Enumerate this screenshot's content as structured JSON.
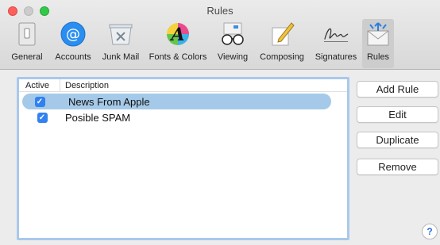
{
  "window": {
    "title": "Rules"
  },
  "toolbar": {
    "items": [
      {
        "label": "General",
        "icon": "general-icon"
      },
      {
        "label": "Accounts",
        "icon": "at-sign-icon"
      },
      {
        "label": "Junk Mail",
        "icon": "trash-bin-icon"
      },
      {
        "label": "Fonts & Colors",
        "icon": "font-a-icon"
      },
      {
        "label": "Viewing",
        "icon": "glasses-icon"
      },
      {
        "label": "Composing",
        "icon": "pencil-icon"
      },
      {
        "label": "Signatures",
        "icon": "signature-icon"
      },
      {
        "label": "Rules",
        "icon": "rules-envelope-icon",
        "selected": true
      }
    ]
  },
  "rules_list": {
    "headers": {
      "active": "Active",
      "description": "Description"
    },
    "rows": [
      {
        "active": true,
        "description": "News From Apple",
        "selected": true
      },
      {
        "active": true,
        "description": "Posible SPAM",
        "selected": false
      }
    ]
  },
  "buttons": {
    "add_rule": "Add Rule",
    "edit": "Edit",
    "duplicate": "Duplicate",
    "remove": "Remove",
    "help": "?"
  },
  "colors": {
    "checkbox": "#2f82f0",
    "selection": "#a5c9e8",
    "accent": "#2f6fd8"
  }
}
